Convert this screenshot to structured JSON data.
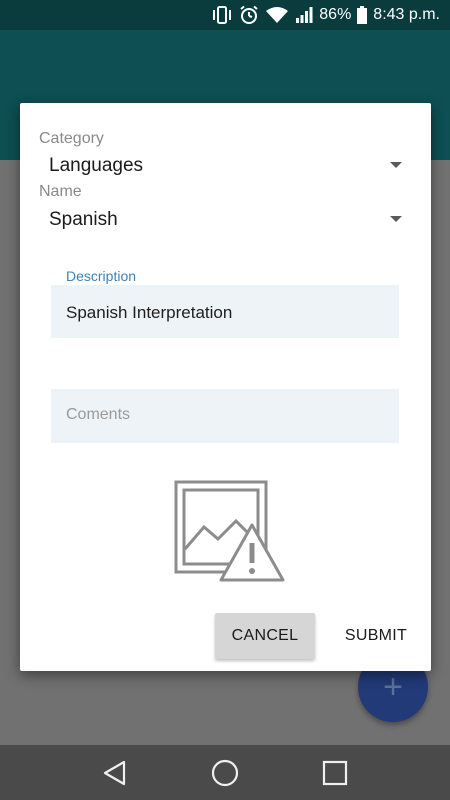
{
  "status_bar": {
    "battery_percent": "86%",
    "time": "8:43 p.m.",
    "icons": [
      "vibrate-icon",
      "alarm-icon",
      "wifi-icon",
      "signal-icon",
      "battery-icon"
    ]
  },
  "dialog": {
    "category": {
      "label": "Category",
      "value": "Languages"
    },
    "name": {
      "label": "Name",
      "value": "Spanish"
    },
    "description": {
      "label": "Description",
      "value": "Spanish Interpretation"
    },
    "comments": {
      "placeholder": "Coments"
    },
    "image": {
      "icon": "broken-image-icon"
    },
    "buttons": {
      "cancel": "CANCEL",
      "submit": "SUBMIT"
    }
  },
  "fab": {
    "icon": "plus-icon",
    "label": "+"
  },
  "nav_bar": {
    "icons": [
      "back-icon",
      "home-icon",
      "recents-icon"
    ]
  },
  "colors": {
    "status_bar": "#0a3c3e",
    "app_bar": "#0d4f52",
    "fab": "#233a78",
    "input_bg": "#eef3f7",
    "float_label": "#3b83b9"
  }
}
